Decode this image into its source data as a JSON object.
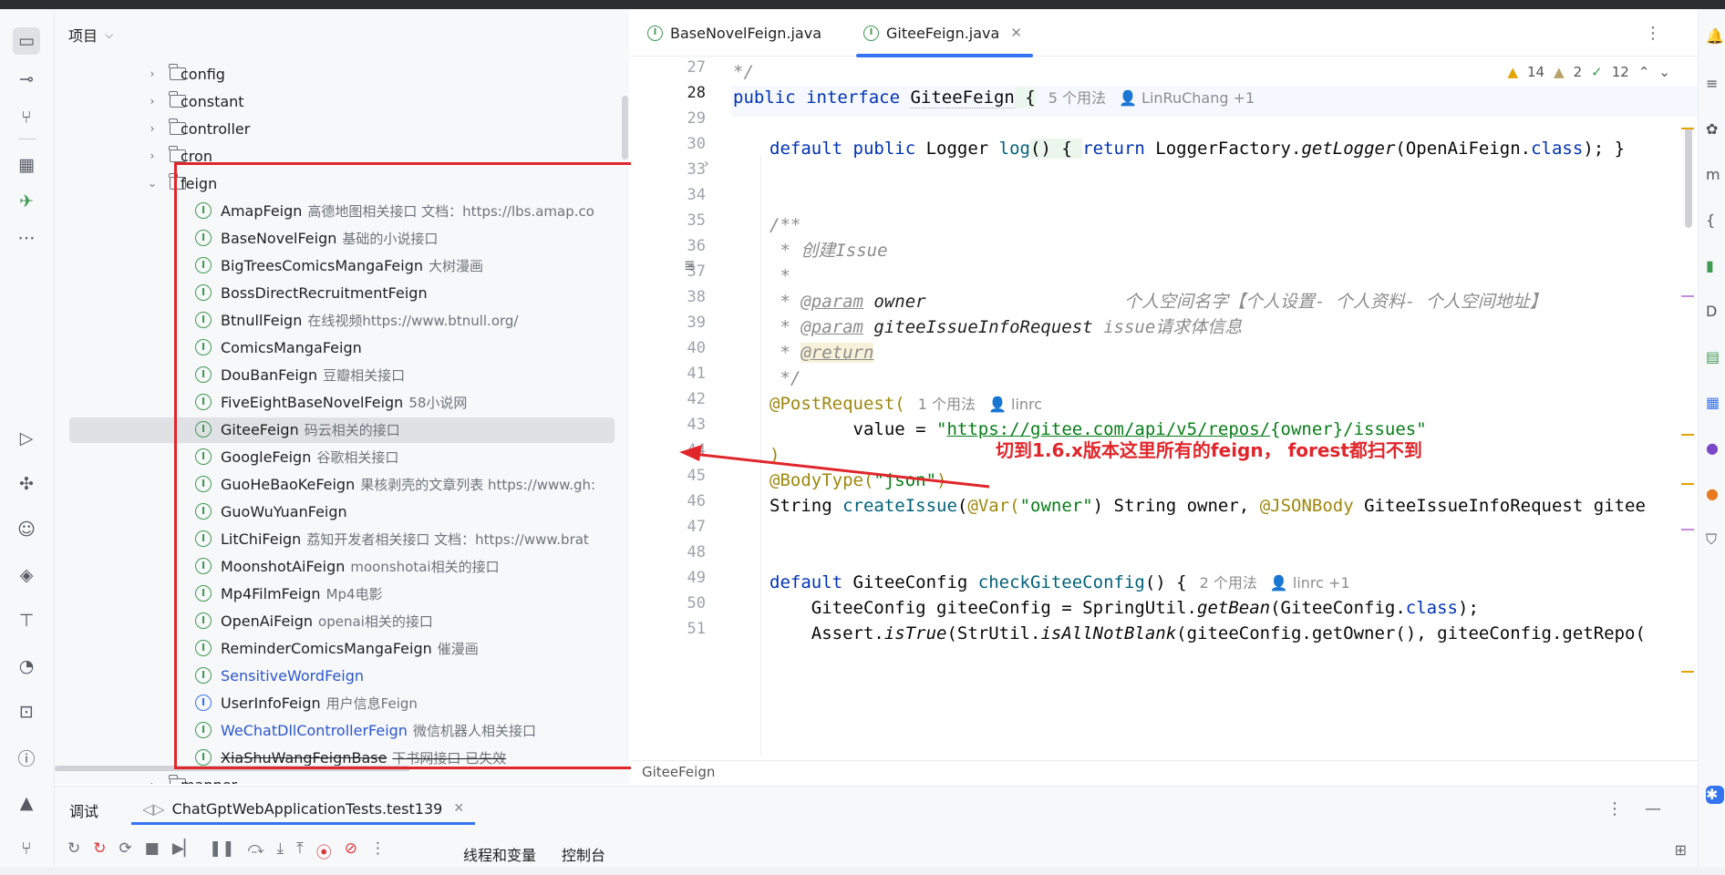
{
  "project_panel": {
    "title": "项目",
    "tree": [
      {
        "name": "config",
        "type": "folder"
      },
      {
        "name": "constant",
        "type": "folder"
      },
      {
        "name": "controller",
        "type": "folder"
      },
      {
        "name": "cron",
        "type": "folder"
      },
      {
        "name": "feign",
        "type": "folder",
        "expanded": true
      },
      {
        "name": "AmapFeign",
        "desc": "高德地图相关接口 文档：https://lbs.amap.co",
        "type": "interface"
      },
      {
        "name": "BaseNovelFeign",
        "desc": "基础的小说接口",
        "type": "interface"
      },
      {
        "name": "BigTreesComicsMangaFeign",
        "desc": "大树漫画",
        "type": "interface"
      },
      {
        "name": "BossDirectRecruitmentFeign",
        "desc": "",
        "type": "interface"
      },
      {
        "name": "BtnullFeign",
        "desc": "在线视频https://www.btnull.org/",
        "type": "interface"
      },
      {
        "name": "ComicsMangaFeign",
        "desc": "",
        "type": "interface"
      },
      {
        "name": "DouBanFeign",
        "desc": "豆瓣相关接口",
        "type": "interface"
      },
      {
        "name": "FiveEightBaseNovelFeign",
        "desc": "58小说网",
        "type": "interface"
      },
      {
        "name": "GiteeFeign",
        "desc": "码云相关的接口",
        "type": "interface",
        "selected": true
      },
      {
        "name": "GoogleFeign",
        "desc": "谷歌相关接口",
        "type": "interface"
      },
      {
        "name": "GuoHeBaoKeFeign",
        "desc": "果核剥壳的文章列表 https://www.gh:",
        "type": "interface"
      },
      {
        "name": "GuoWuYuanFeign",
        "desc": "",
        "type": "interface"
      },
      {
        "name": "LitChiFeign",
        "desc": "荔知开发者相关接口 文档：https://www.brat",
        "type": "interface"
      },
      {
        "name": "MoonshotAiFeign",
        "desc": "moonshotai相关的接口",
        "type": "interface"
      },
      {
        "name": "Mp4FilmFeign",
        "desc": "Mp4电影",
        "type": "interface"
      },
      {
        "name": "OpenAiFeign",
        "desc": "openai相关的接口",
        "type": "interface"
      },
      {
        "name": "ReminderComicsMangaFeign",
        "desc": "催漫画",
        "type": "interface"
      },
      {
        "name": "SensitiveWordFeign",
        "desc": "",
        "type": "interface",
        "color": "blue"
      },
      {
        "name": "UserInfoFeign",
        "desc": "用户信息Feign",
        "type": "interface-alt"
      },
      {
        "name": "WeChatDllControllerFeign",
        "desc": "微信机器人相关接口",
        "type": "interface",
        "color": "blue"
      },
      {
        "name": "XiaShuWangFeignBase",
        "desc": "下书网接口 已失效",
        "type": "interface",
        "strike": true
      },
      {
        "name": "mapper",
        "type": "folder"
      }
    ]
  },
  "editor": {
    "tabs": [
      {
        "label": "BaseNovelFeign.java",
        "active": false
      },
      {
        "label": "GiteeFeign.java",
        "active": true
      }
    ],
    "inspections": {
      "warnings": "14",
      "weak_warnings": "2",
      "ok": "12"
    },
    "line_numbers": [
      "27",
      "28",
      "29",
      "30",
      "33",
      "34",
      "35",
      "36",
      "37",
      "38",
      "39",
      "40",
      "41",
      "42",
      "43",
      "44",
      "45",
      "46",
      "47",
      "48",
      "49",
      "50",
      "51"
    ],
    "current_line": "28",
    "lines": {
      "l27": "*/",
      "l28_a": "public interface ",
      "l28_b": "GiteeFeign",
      "l28_c": " {",
      "l28_usage": "5 个用法",
      "l28_author": "LinRuChang +1",
      "l30_a": "default public ",
      "l30_b": "Logger ",
      "l30_c": "log",
      "l30_d": "() { ",
      "l30_e": "return ",
      "l30_f": "LoggerFactory.",
      "l30_g": "getLogger",
      "l30_h": "(OpenAiFeign.",
      "l30_i": "class",
      "l30_j": "); }",
      "l35": "/**",
      "l36": " * 创建Issue",
      "l37": " *",
      "l38_a": " * ",
      "l38_b": "@param",
      "l38_c": " owner",
      "l38_d": "                   个人空间名字【个人设置- 个人资料- 个人空间地址】",
      "l39_a": " * ",
      "l39_b": "@param",
      "l39_c": " giteeIssueInfoRequest",
      "l39_d": " issue请求体信息",
      "l40_a": " * ",
      "l40_b": "@return",
      "l41": " */",
      "l42_a": "@PostRequest(",
      "l42_usage": "1 个用法",
      "l42_author": "linrc",
      "l43_a": "        value = ",
      "l43_b": "\"",
      "l43_c": "https://gitee.com/api/v5/repos/",
      "l43_d": "{owner}/issues",
      "l43_e": "\"",
      "l44": ")",
      "l45_a": "@BodyType(",
      "l45_b": "\"json\"",
      "l45_c": ")",
      "l46_a": "String ",
      "l46_b": "createIssue",
      "l46_c": "(",
      "l46_d": "@Var(",
      "l46_e": "\"owner\"",
      "l46_f": ") String owner, ",
      "l46_g": "@JSONBody ",
      "l46_h": "GiteeIssueInfoRequest gitee",
      "l49_a": "default ",
      "l49_b": "GiteeConfig ",
      "l49_c": "checkGiteeConfig",
      "l49_d": "() {",
      "l49_usage": "2 个用法",
      "l49_author": "linrc +1",
      "l50_a": "    GiteeConfig giteeConfig = SpringUtil.",
      "l50_b": "getBean",
      "l50_c": "(GiteeConfig.",
      "l50_d": "class",
      "l50_e": ");",
      "l51_a": "    Assert.",
      "l51_b": "isTrue",
      "l51_c": "(StrUtil.",
      "l51_d": "isAllNotBlank",
      "l51_e": "(giteeConfig.getOwner(), giteeConfig.getRepo("
    },
    "breadcrumb": "GiteeFeign"
  },
  "annotation": "切到1.6.x版本这里所有的feign， forest都扫不到",
  "debug": {
    "title": "调试",
    "tab": "ChatGptWebApplicationTests.test139",
    "threads_label": "线程和变量",
    "console_label": "控制台"
  },
  "colors": {
    "accent": "#3574f0",
    "annotation_red": "#e0262b",
    "interface_green": "#3f9a53"
  }
}
